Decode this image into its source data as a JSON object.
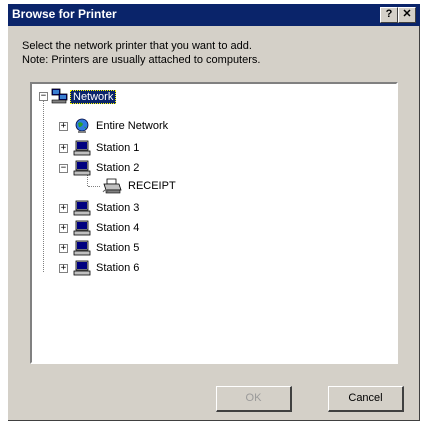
{
  "window": {
    "title": "Browse for Printer",
    "help_label": "?",
    "close_label": "✕"
  },
  "instructions": {
    "line1": "Select the network printer that you want to add.",
    "line2": "Note: Printers are usually attached to computers."
  },
  "tree": {
    "root": {
      "label": "Network",
      "expander": "−",
      "icon": "network-icon"
    },
    "items": [
      {
        "label": "Entire Network",
        "expander": "+",
        "icon": "globe-icon"
      },
      {
        "label": "Station 1",
        "expander": "+",
        "icon": "computer-icon"
      },
      {
        "label": "Station 2",
        "expander": "−",
        "icon": "computer-icon"
      },
      {
        "label": "RECEIPT",
        "icon": "printer-icon"
      },
      {
        "label": "Station 3",
        "expander": "+",
        "icon": "computer-icon"
      },
      {
        "label": "Station 4",
        "expander": "+",
        "icon": "computer-icon"
      },
      {
        "label": "Station 5",
        "expander": "+",
        "icon": "computer-icon"
      },
      {
        "label": "Station 6",
        "expander": "+",
        "icon": "computer-icon"
      }
    ]
  },
  "buttons": {
    "ok_label": "OK",
    "cancel_label": "Cancel"
  },
  "colors": {
    "titlebar": "#0a246a",
    "dialog_face": "#d4d0c8",
    "selection": "#0a246a"
  }
}
